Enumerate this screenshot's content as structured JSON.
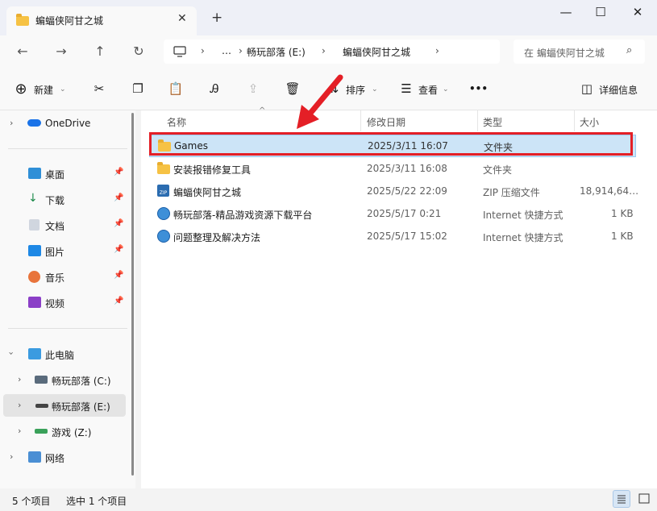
{
  "window": {
    "tab_title": "蝙蝠侠阿甘之城",
    "tab_close": "✕",
    "new_tab": "+",
    "minimize": "—",
    "maximize": "☐",
    "close": "✕"
  },
  "nav": {
    "back": "←",
    "forward": "→",
    "up": "↑",
    "refresh": "↻",
    "breadcrumbs": [
      "…",
      "畅玩部落 (E:)",
      "蝙蝠侠阿甘之城"
    ],
    "search_placeholder": "在 蝙蝠侠阿甘之城"
  },
  "toolbar": {
    "new_label": "新建",
    "sort_label": "排序",
    "view_label": "查看",
    "more": "•••",
    "details_label": "详细信息"
  },
  "sidebar": {
    "onedrive": "OneDrive",
    "quick": [
      {
        "label": "桌面"
      },
      {
        "label": "下载"
      },
      {
        "label": "文档"
      },
      {
        "label": "图片"
      },
      {
        "label": "音乐"
      },
      {
        "label": "视频"
      }
    ],
    "this_pc": "此电脑",
    "drives": [
      {
        "label": "畅玩部落 (C:)"
      },
      {
        "label": "畅玩部落 (E:)"
      },
      {
        "label": "游戏 (Z:)"
      }
    ],
    "network": "网络"
  },
  "columns": {
    "name": "名称",
    "modified": "修改日期",
    "type": "类型",
    "size": "大小"
  },
  "files": [
    {
      "name": "Games",
      "modified": "2025/3/11 16:07",
      "type": "文件夹",
      "size": "",
      "icon": "folder-icon"
    },
    {
      "name": "安装报错修复工具",
      "modified": "2025/3/11 16:08",
      "type": "文件夹",
      "size": "",
      "icon": "folder-icon"
    },
    {
      "name": "蝙蝠侠阿甘之城",
      "modified": "2025/5/22 22:09",
      "type": "ZIP 压缩文件",
      "size": "18,914,64…",
      "icon": "zip-icon"
    },
    {
      "name": "畅玩部落-精品游戏资源下载平台",
      "modified": "2025/5/17 0:21",
      "type": "Internet 快捷方式",
      "size": "1 KB",
      "icon": "internet-shortcut-icon"
    },
    {
      "name": "问题整理及解决方法",
      "modified": "2025/5/17 15:02",
      "type": "Internet 快捷方式",
      "size": "1 KB",
      "icon": "internet-shortcut-icon"
    }
  ],
  "status": {
    "count": "5 个项目",
    "selected": "选中 1 个项目"
  },
  "colors": {
    "selection": "#cce4f7",
    "highlight_box": "#e41f26",
    "folder": "#f6c244"
  }
}
